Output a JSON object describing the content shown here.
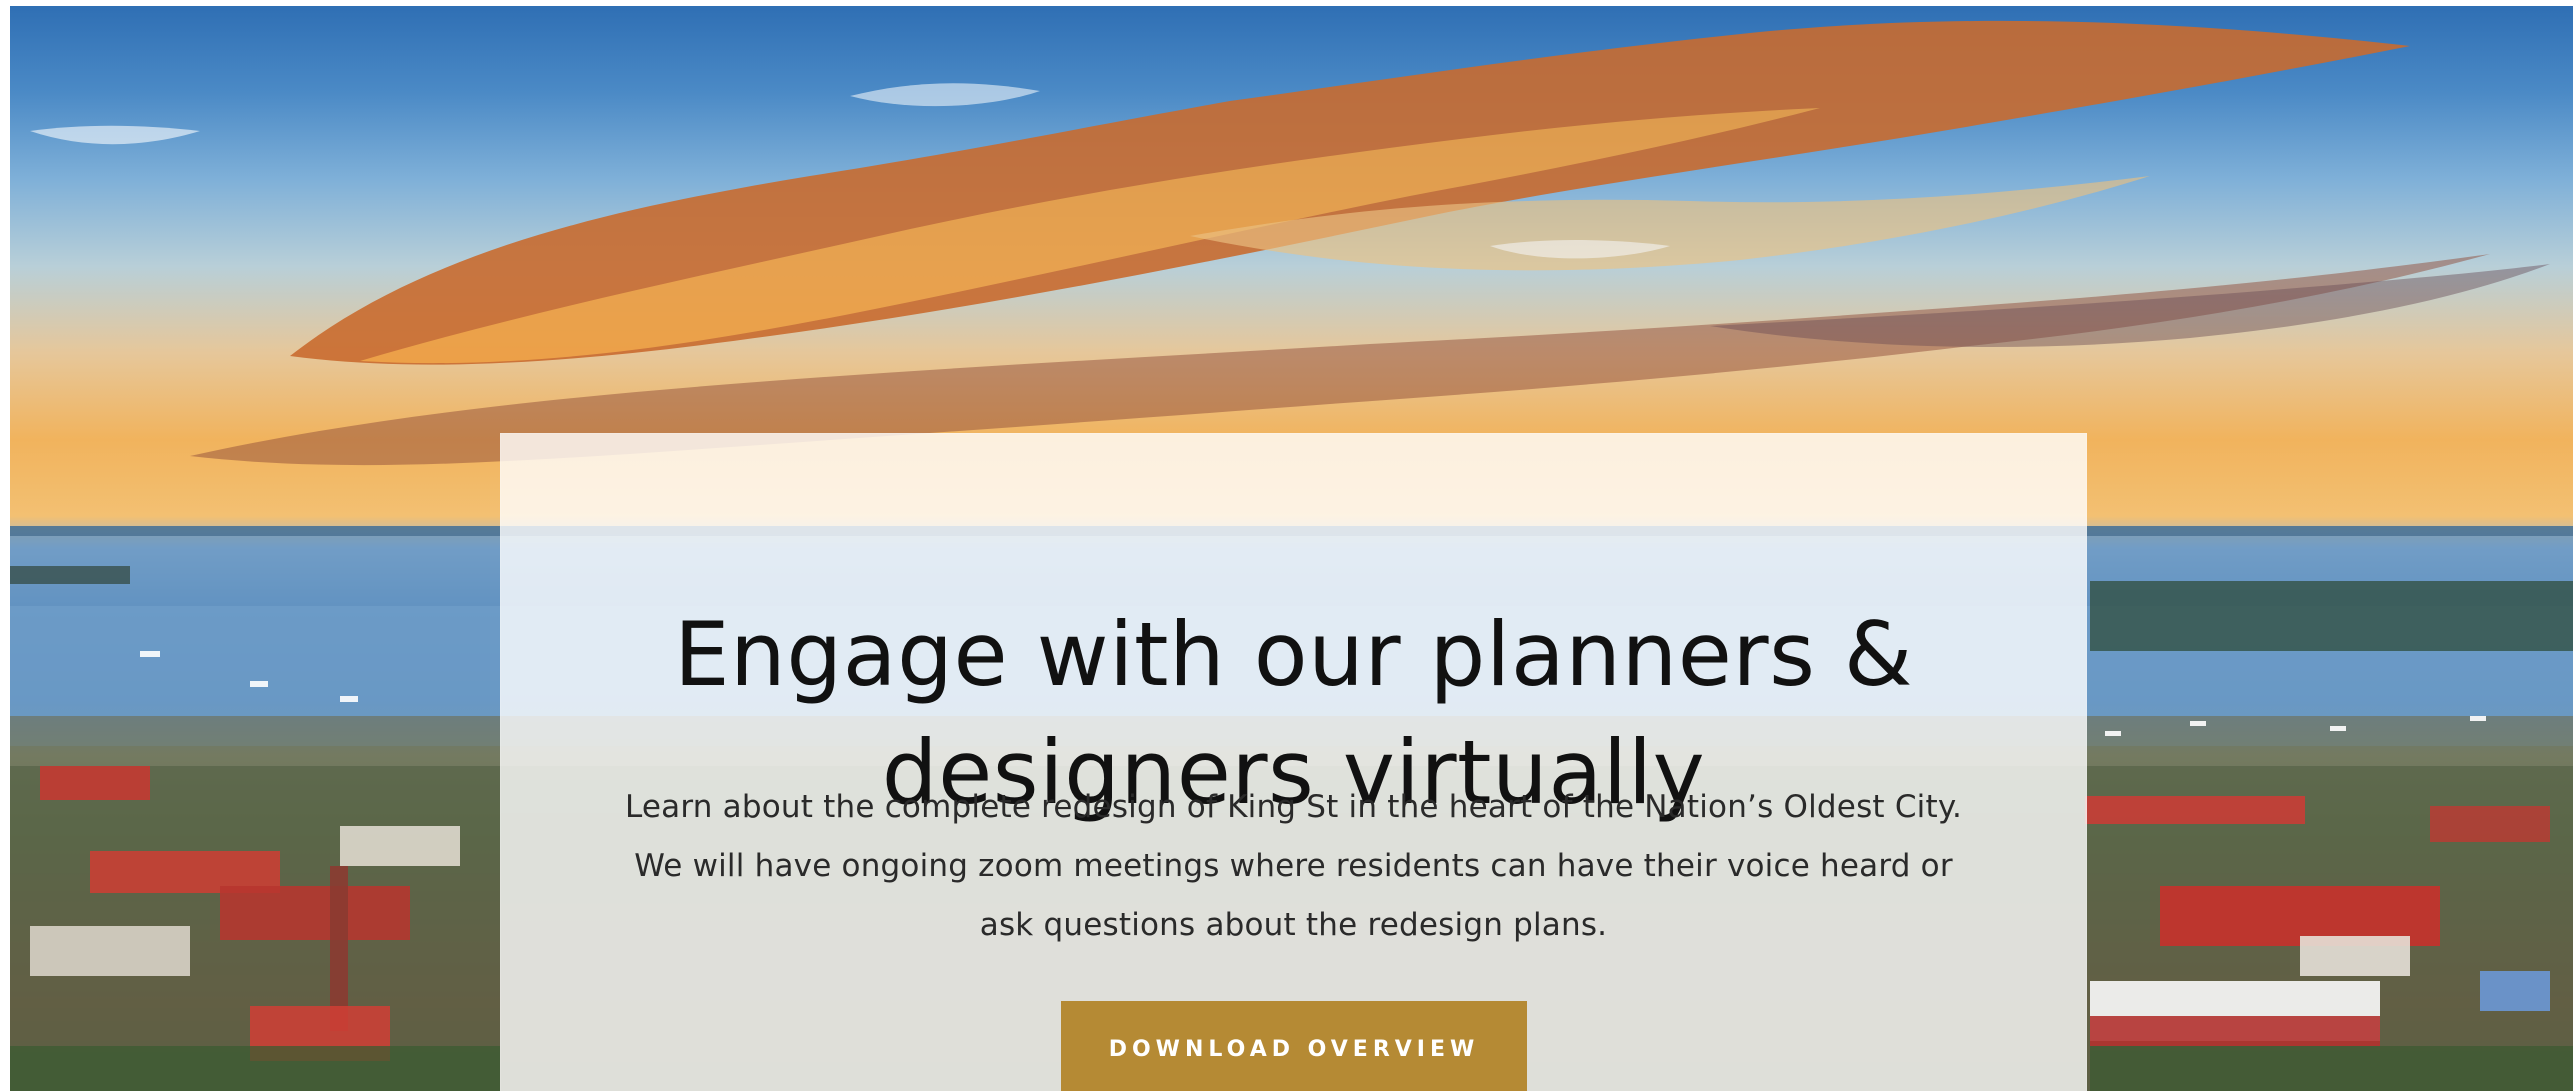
{
  "hero": {
    "title_line1": "Engage with our planners &",
    "title_line2": "designers virtually",
    "description_line1": "Learn about the complete redesign of King St in the heart of the Nation’s Oldest City.",
    "description_line2": "We will have ongoing zoom meetings where residents can have their voice heard or",
    "description_line3": "ask questions about the redesign plans.",
    "button_label": "DOWNLOAD OVERVIEW"
  },
  "colors": {
    "button": "#b58a34",
    "card_overlay": "#ffffff",
    "text": "#111111"
  }
}
